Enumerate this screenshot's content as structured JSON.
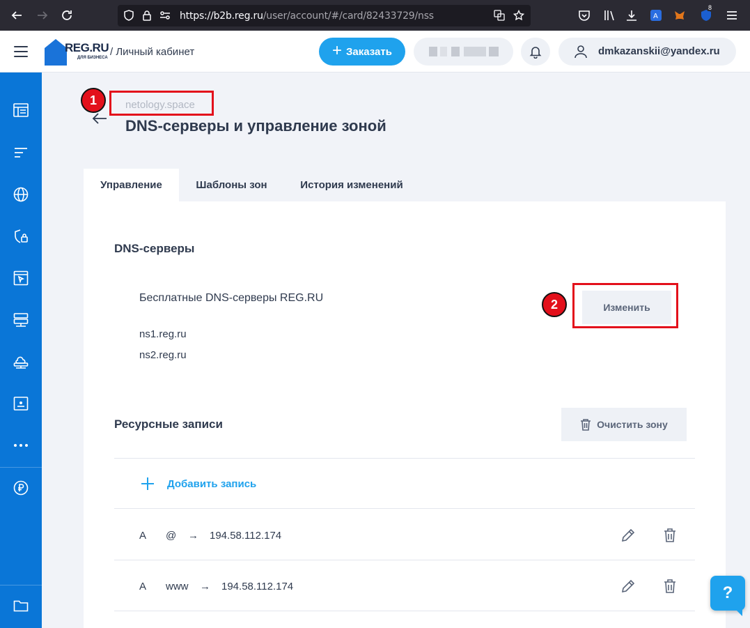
{
  "browser": {
    "url_host": "https://b2b.reg.ru",
    "url_path": "/user/account/#/card/82433729/nss",
    "badge_count": "8"
  },
  "header": {
    "logo_text": "REG.RU",
    "logo_subtext": "ДЛЯ БИЗНЕСА",
    "breadcrumb": "/ Личный кабинет",
    "order_label": "Заказать",
    "user_email": "dmkazanskii@yandex.ru"
  },
  "sidebar": {
    "items": [
      "table-icon",
      "list-icon",
      "globe-icon",
      "shield-lock-icon",
      "window-cursor-icon",
      "server-icon",
      "cloud-server-icon",
      "monitor-icon",
      "more-icon",
      "ruble-icon",
      "folder-icon"
    ]
  },
  "page": {
    "domain": "netology.space",
    "title": "DNS-серверы и управление зоной"
  },
  "tabs": [
    {
      "label": "Управление",
      "active": true
    },
    {
      "label": "Шаблоны зон",
      "active": false
    },
    {
      "label": "История изменений",
      "active": false
    }
  ],
  "dns": {
    "heading": "DNS-серверы",
    "provider": "Бесплатные DNS-серверы REG.RU",
    "servers": [
      "ns1.reg.ru",
      "ns2.reg.ru"
    ],
    "change_label": "Изменить"
  },
  "records": {
    "heading": "Ресурсные записи",
    "clear_label": "Очистить зону",
    "add_label": "Добавить запись",
    "arrow": "→",
    "items": [
      {
        "type": "A",
        "name": "@",
        "value": "194.58.112.174"
      },
      {
        "type": "A",
        "name": "www",
        "value": "194.58.112.174"
      }
    ]
  },
  "annotations": {
    "marker1": "1",
    "marker2": "2",
    "color": "#e3101b"
  },
  "help_label": "?",
  "colors": {
    "accent": "#1fa2ed",
    "sidebar": "#0a76d7",
    "text": "#2f3a4e"
  }
}
